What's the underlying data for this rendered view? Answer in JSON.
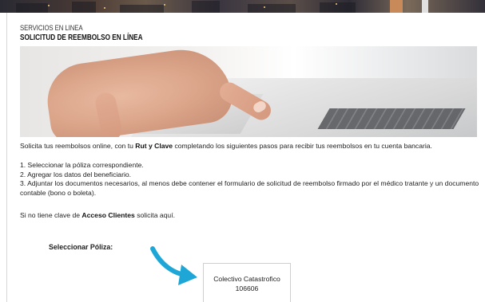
{
  "header": {
    "section_label": "SERVICIOS EN LINEA",
    "page_title": "SOLICITUD DE REEMBOLSO EN LÍNEA"
  },
  "intro": {
    "text_before": "Solicita tus reembolsos online, con tu ",
    "bold": "Rut y Clave",
    "text_after": " completando los siguientes pasos para recibir tus reembolsos en tu cuenta bancaria."
  },
  "steps": [
    "1. Seleccionar la póliza correspondiente.",
    "2. Agregar los datos del beneficiario.",
    "3. Adjuntar los documentos necesarios, al menos debe contener el formulario de solicitud de reembolso firmado por el médico tratante y un documento contable (bono o boleta)."
  ],
  "access": {
    "text_before": "Si no tiene clave de ",
    "link_label": "Acceso Clientes",
    "text_after": " solicita aquí."
  },
  "policy_select": {
    "label": "Seleccionar Póliza:",
    "options": [
      {
        "name": "Colectivo Catastrofico",
        "number": "106606"
      }
    ]
  },
  "colors": {
    "arrow": "#1ea7d6",
    "border": "#cfcfcf"
  }
}
